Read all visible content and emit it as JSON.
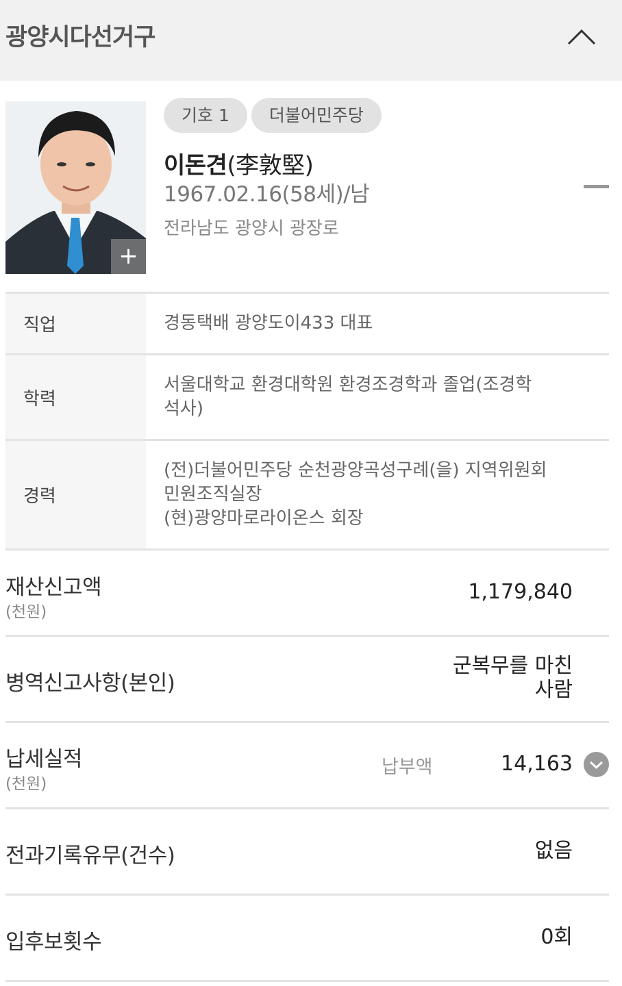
{
  "header": {
    "title": "광양시다선거구",
    "collapse_icon": "chevron-up-icon"
  },
  "candidate": {
    "number_badge": "기호 1",
    "party_badge": "더불어민주당",
    "name": "이돈견",
    "name_hanja": "(李敦堅)",
    "birth": "1967.02.16(58세)/남",
    "address": "전라남도 광양시 광장로",
    "photo_zoom_label": "+",
    "photo_icon": "candidate-photo",
    "minus_icon": "minus-icon"
  },
  "details": {
    "job_label": "직업",
    "job_value": "경동택배 광양도이433 대표",
    "edu_label": "학력",
    "edu_line1": "서울대학교 환경대학원 환경조경학과 졸업(조경학",
    "edu_line2": "석사)",
    "career_label": "경력",
    "career_line1": "(전)더불어민주당 순천광양곡성구례(을) 지역위원회",
    "career_line2": "민원조직실장",
    "career_line3": "(현)광양마로라이온스 회장"
  },
  "stats": {
    "property_label": "재산신고액",
    "property_unit": "(천원)",
    "property_value": "1,179,840",
    "military_label": "병역신고사항(본인)",
    "military_line1": "군복무를 마친",
    "military_line2": "사람",
    "tax_label": "납세실적",
    "tax_unit": "(천원)",
    "tax_sub": "납부액",
    "tax_value": "14,163",
    "tax_expand_icon": "chevron-down-circle-icon",
    "criminal_label": "전과기록유무(건수)",
    "criminal_value": "없음",
    "candidacy_label": "입후보횟수",
    "candidacy_value": "0회"
  },
  "colors": {
    "header_bg": "#f1f1f1",
    "badge_bg": "#e2e2e2",
    "label_bg": "#f6f6f6",
    "divider": "#e3e3e3",
    "tie_blue": "#2f8fd1"
  }
}
